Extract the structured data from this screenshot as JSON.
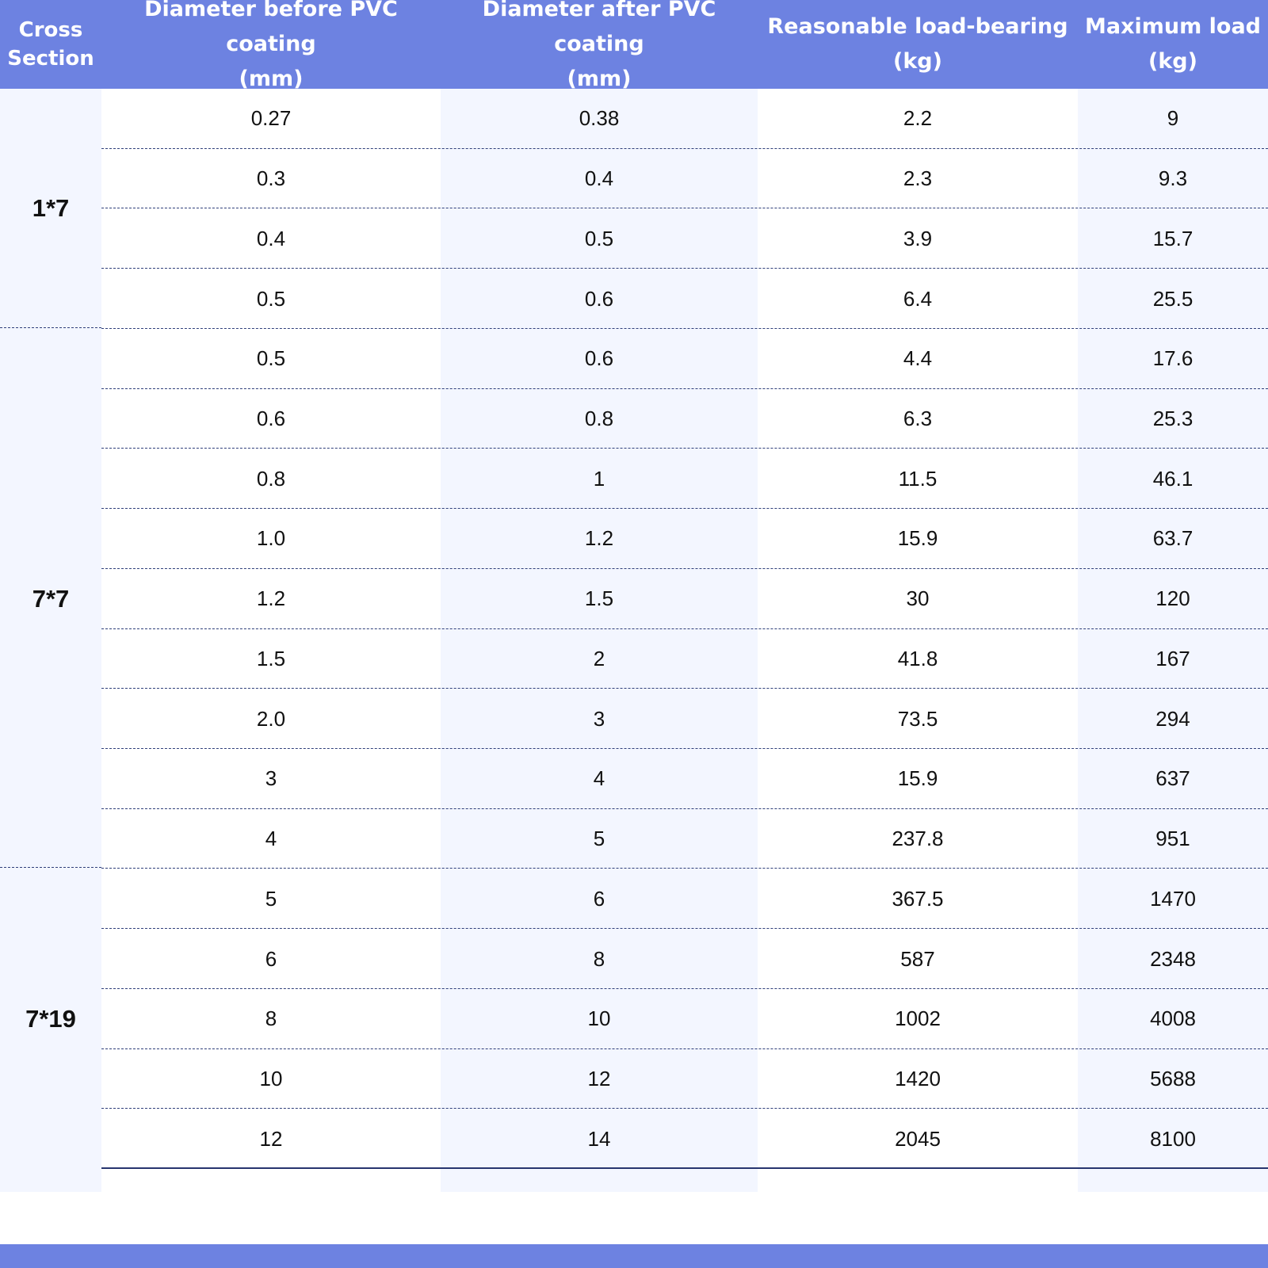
{
  "headers": [
    "Cross\nSection",
    "Diameter before PVC coating\n(mm)",
    "Diameter after PVC coating\n(mm)",
    "Reasonable load-bearing\n(kg)",
    "Maximum load\n(kg)"
  ],
  "groups": [
    {
      "label": "1*7",
      "rows": [
        [
          "0.27",
          "0.38",
          "2.2",
          "9"
        ],
        [
          "0.3",
          "0.4",
          "2.3",
          "9.3"
        ],
        [
          "0.4",
          "0.5",
          "3.9",
          "15.7"
        ],
        [
          "0.5",
          "0.6",
          "6.4",
          "25.5"
        ]
      ]
    },
    {
      "label": "7*7",
      "rows": [
        [
          "0.5",
          "0.6",
          "4.4",
          "17.6"
        ],
        [
          "0.6",
          "0.8",
          "6.3",
          "25.3"
        ],
        [
          "0.8",
          "1",
          "11.5",
          "46.1"
        ],
        [
          "1.0",
          "1.2",
          "15.9",
          "63.7"
        ],
        [
          "1.2",
          "1.5",
          "30",
          "120"
        ],
        [
          "1.5",
          "2",
          "41.8",
          "167"
        ],
        [
          "2.0",
          "3",
          "73.5",
          "294"
        ],
        [
          "3",
          "4",
          "15.9",
          "637"
        ],
        [
          "4",
          "5",
          "237.8",
          "951"
        ]
      ]
    },
    {
      "label": "7*19",
      "rows": [
        [
          "5",
          "6",
          "367.5",
          "1470"
        ],
        [
          "6",
          "8",
          "587",
          "2348"
        ],
        [
          "8",
          "10",
          "1002",
          "4008"
        ],
        [
          "10",
          "12",
          "1420",
          "5688"
        ],
        [
          "12",
          "14",
          "2045",
          "8100"
        ]
      ]
    }
  ],
  "colors": {
    "header_bg": "#6d82e1",
    "header_text": "#ffffff",
    "row_shade": "#f3f6ff",
    "divider": "#2f3f7a"
  }
}
